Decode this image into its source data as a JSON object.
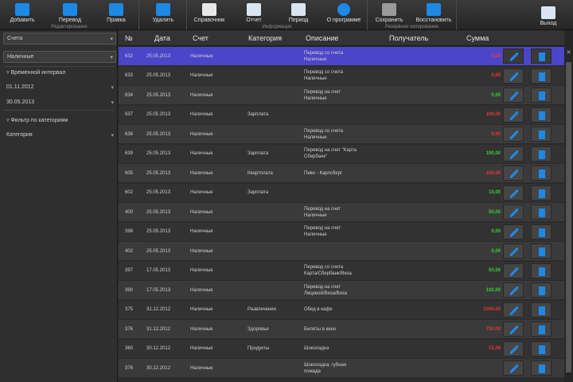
{
  "ribbon": {
    "buttons": [
      {
        "label": "Добавить",
        "icon": "plus-icon"
      },
      {
        "label": "Перевод",
        "icon": "transfer-icon"
      },
      {
        "label": "Правка",
        "icon": "edit-icon"
      },
      {
        "label": "Удалить",
        "icon": "trash-icon"
      },
      {
        "label": "Справочник",
        "icon": "book-icon"
      },
      {
        "label": "Отчет",
        "icon": "report-icon"
      },
      {
        "label": "Период",
        "icon": "calendar-icon"
      },
      {
        "label": "О программе",
        "icon": "info-icon"
      },
      {
        "label": "Сохранить",
        "icon": "save-icon"
      },
      {
        "label": "Восстановить",
        "icon": "restore-icon"
      },
      {
        "label": "Выход",
        "icon": "exit-icon"
      }
    ],
    "groups": [
      "Редактирование",
      "Информация",
      "Резервное копирование"
    ]
  },
  "left": {
    "combo1": "Счета",
    "combo2": "Наличные",
    "item1": "Временной интервал",
    "date_from": "01.11.2012",
    "date_to": "30.05.2013",
    "item2": "Фильтр по категориям",
    "combo3": "Категория"
  },
  "table": {
    "headers": [
      "№",
      "Дата",
      "Счет",
      "Категория",
      "Описание",
      "Получатель",
      "Сумма"
    ],
    "rows": [
      {
        "n": "632",
        "date": "25.05.2013",
        "acc": "Наличные",
        "cat": "",
        "d1": "Перевод со счета",
        "d2": "Наличные",
        "amt": "0,00",
        "sign": "neg",
        "sel": true
      },
      {
        "n": "633",
        "date": "25.05.2013",
        "acc": "Наличные",
        "cat": "",
        "d1": "Перевод со счета",
        "d2": "Наличные",
        "amt": "0,00",
        "sign": "neg"
      },
      {
        "n": "634",
        "date": "25.05.2013",
        "acc": "Наличные",
        "cat": "",
        "d1": "Перевод на счет",
        "d2": "Наличные",
        "amt": "0,00",
        "sign": "pos"
      },
      {
        "n": "637",
        "date": "25.05.2013",
        "acc": "Наличные",
        "cat": "Зарплата",
        "d1": "",
        "d2": "",
        "amt": "100,00",
        "sign": "neg"
      },
      {
        "n": "638",
        "date": "25.05.2013",
        "acc": "Наличные",
        "cat": "",
        "d1": "Перевод со счета",
        "d2": "Наличные",
        "amt": "0,00",
        "sign": "neg"
      },
      {
        "n": "639",
        "date": "25.05.2013",
        "acc": "Наличные",
        "cat": "Зарплата",
        "d1": "Перевод на счет \"Карта",
        "d2": "Сбербанк\"",
        "amt": "100,00",
        "sign": "pos"
      },
      {
        "n": "605",
        "date": "25.05.2013",
        "acc": "Наличные",
        "cat": "Квартплата",
        "d1": "Пиво - Карлсберг",
        "d2": "",
        "amt": "100,00",
        "sign": "neg"
      },
      {
        "n": "602",
        "date": "25.05.2013",
        "acc": "Наличные",
        "cat": "Зарплата",
        "d1": "",
        "d2": "",
        "amt": "10,00",
        "sign": "pos"
      },
      {
        "n": "400",
        "date": "25.05.2013",
        "acc": "Наличные",
        "cat": "",
        "d1": "Перевод на счет",
        "d2": "Наличные",
        "amt": "50,00",
        "sign": "pos"
      },
      {
        "n": "398",
        "date": "25.05.2013",
        "acc": "Наличные",
        "cat": "",
        "d1": "Перевод на счет",
        "d2": "Наличные",
        "amt": "0,00",
        "sign": "pos"
      },
      {
        "n": "402",
        "date": "25.05.2013",
        "acc": "Наличные",
        "cat": "",
        "d1": "",
        "d2": "",
        "amt": "0,00",
        "sign": "pos"
      },
      {
        "n": "397",
        "date": "17.05.2013",
        "acc": "Наличные",
        "cat": "",
        "d1": "Перевод со счета",
        "d2": "Карта/Сбербанк/Виза",
        "amt": "50,00",
        "sign": "pos"
      },
      {
        "n": "390",
        "date": "17.05.2013",
        "acc": "Наличные",
        "cat": "",
        "d1": "Перевод на счет",
        "d2": "Лицевой/Виза/Виза",
        "amt": "100,00",
        "sign": "pos"
      },
      {
        "n": "375",
        "date": "31.12.2012",
        "acc": "Наличные",
        "cat": "Развлечения",
        "d1": "Обед в кафе",
        "d2": "",
        "amt": "1000,00",
        "sign": "neg"
      },
      {
        "n": "376",
        "date": "31.12.2012",
        "acc": "Наличные",
        "cat": "Здоровье",
        "d1": "Билеты в кино",
        "d2": "",
        "amt": "750,00",
        "sign": "neg"
      },
      {
        "n": "360",
        "date": "30.12.2012",
        "acc": "Наличные",
        "cat": "Продукты",
        "d1": "Шоколадка",
        "d2": "",
        "amt": "15,00",
        "sign": "neg"
      },
      {
        "n": "376",
        "date": "30.12.2012",
        "acc": "Наличные",
        "cat": "",
        "d1": "Шоколадка, губная",
        "d2": "помада",
        "amt": "",
        "sign": "neg"
      }
    ]
  },
  "colors": {
    "accent": "#1e88e5",
    "selected": "#4b45c9",
    "positive": "#35d035",
    "negative": "#e53935"
  }
}
